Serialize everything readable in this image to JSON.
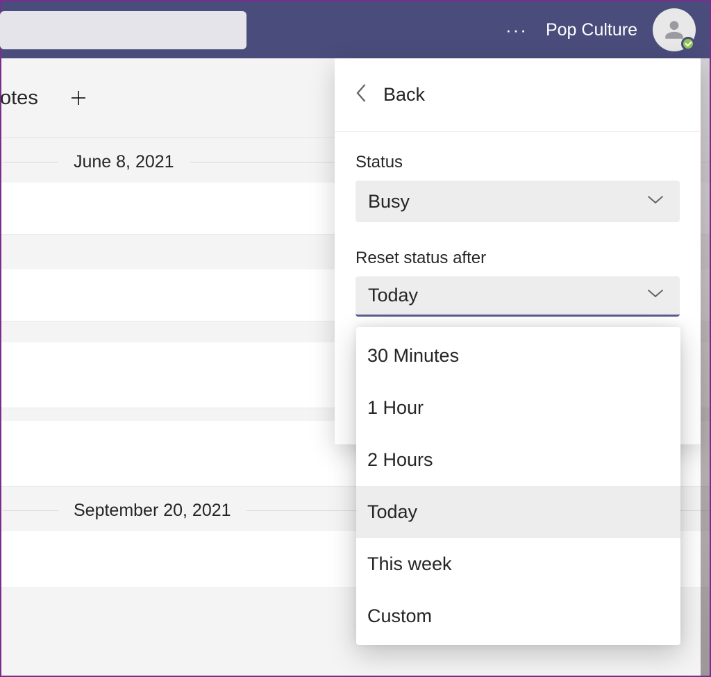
{
  "header": {
    "tenant": "Pop Culture",
    "search_placeholder": ""
  },
  "tabs": {
    "label": "otes"
  },
  "dates": {
    "group1": "June 8, 2021",
    "group2": "September 20, 2021"
  },
  "panel": {
    "back_label": "Back",
    "status_label": "Status",
    "status_value": "Busy",
    "reset_label": "Reset status after",
    "reset_value": "Today",
    "options": {
      "opt0": "30 Minutes",
      "opt1": "1 Hour",
      "opt2": "2 Hours",
      "opt3": "Today",
      "opt4": "This week",
      "opt5": "Custom"
    }
  }
}
